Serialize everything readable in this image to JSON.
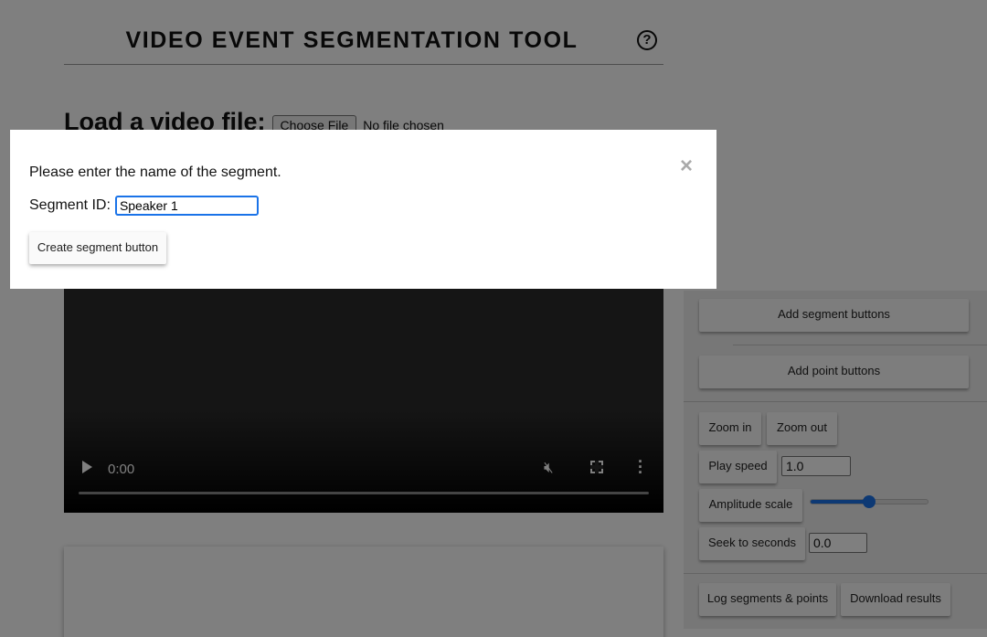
{
  "app": {
    "title": "VIDEO EVENT SEGMENTATION TOOL",
    "help_symbol": "?"
  },
  "loader": {
    "label": "Load a video file:",
    "choose_button": "Choose File",
    "status": "No file chosen"
  },
  "video": {
    "time": "0:00",
    "icons": [
      "play-icon",
      "mute-icon",
      "fullscreen-icon",
      "more-options-icon"
    ]
  },
  "controls": {
    "add_segment_buttons": "Add segment buttons",
    "add_point_buttons": "Add point buttons",
    "zoom_in": "Zoom in",
    "zoom_out": "Zoom out",
    "play_speed_label": "Play speed",
    "play_speed_value": "1.0",
    "amplitude_label": "Amplitude scale",
    "amplitude_level": 0.5,
    "seek_label": "Seek to seconds",
    "seek_value": "0.0",
    "log_button": "Log segments & points",
    "download_button": "Download results"
  },
  "modal": {
    "prompt": "Please enter the name of the segment.",
    "field_label": "Segment ID:",
    "field_value": "Speaker 1",
    "create_button": "Create segment button",
    "close_symbol": "×"
  },
  "colors": {
    "accent": "#1a73e8",
    "overlay": "rgba(0,0,0,0.5)"
  }
}
